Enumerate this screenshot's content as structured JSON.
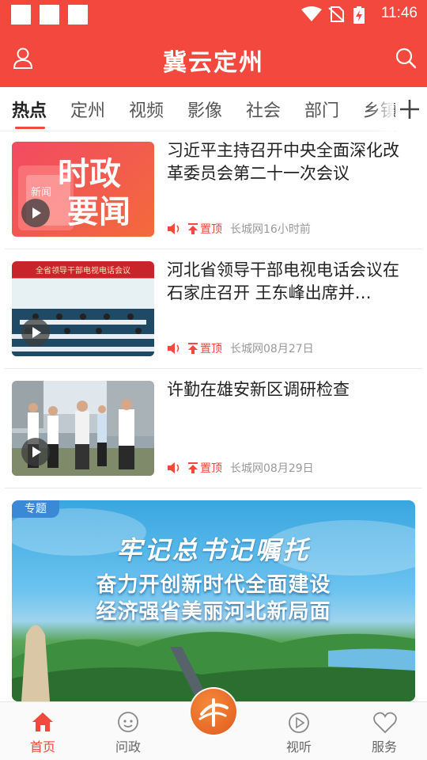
{
  "status_bar": {
    "time": "11:46"
  },
  "header": {
    "title": "冀云定州"
  },
  "tabs": [
    {
      "label": "热点",
      "active": true
    },
    {
      "label": "定州"
    },
    {
      "label": "视频"
    },
    {
      "label": "影像"
    },
    {
      "label": "社会"
    },
    {
      "label": "部门"
    },
    {
      "label": "乡镇"
    }
  ],
  "news": [
    {
      "title": "习近平主持召开中央全面深化改革委员会第二十一次会议",
      "pin": "置顶",
      "source": "长城网16小时前",
      "thumb_text": [
        "时政",
        "要闻"
      ],
      "thumb_small": "新闻"
    },
    {
      "title": "河北省领导干部电视电话会议在石家庄召开 王东峰出席并…",
      "pin": "置顶",
      "source": "长城网08月27日",
      "thumb_text": [
        "全省领导干部电视电话会议"
      ]
    },
    {
      "title": "许勤在雄安新区调研检查",
      "pin": "置顶",
      "source": "长城网08月29日"
    }
  ],
  "banner": {
    "badge": "专题",
    "line1": "牢记总书记嘱托",
    "line2": "奋力开创新时代全面建设",
    "line3": "经济强省美丽河北新局面"
  },
  "bottom_nav": [
    {
      "label": "首页",
      "icon": "home-icon",
      "active": true
    },
    {
      "label": "问政",
      "icon": "chat-icon"
    },
    {
      "label": "",
      "icon": "center-logo-icon"
    },
    {
      "label": "视听",
      "icon": "play-circle-icon"
    },
    {
      "label": "服务",
      "icon": "heart-icon"
    }
  ],
  "colors": {
    "brand_red": "#f2483d",
    "badge_blue": "#3b89d6"
  }
}
